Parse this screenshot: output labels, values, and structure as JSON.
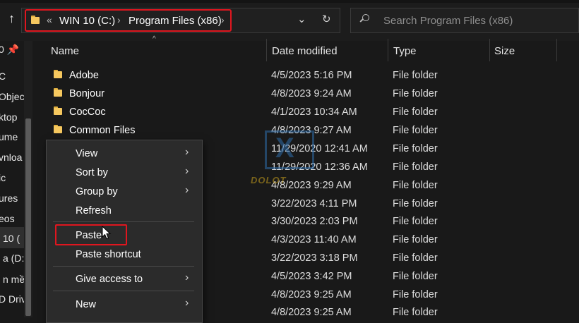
{
  "toolbar": {
    "up_arrow": "↑",
    "breadcrumb_overflow": "«",
    "breadcrumbs": [
      "WIN 10 (C:)",
      "Program Files (x86)"
    ],
    "crumb_separator": "›",
    "dropdown_glyph": "⌄",
    "refresh_glyph": "↻",
    "search_placeholder": "Search Program Files (x86)"
  },
  "navpane": {
    "items": [
      "0 📌",
      "C",
      "Objec",
      "ktop",
      "ume",
      "vnloa",
      "ic",
      "ures",
      "eos",
      "10 (",
      "a (D:",
      "n mề",
      "D Driv"
    ]
  },
  "columns": {
    "name": "Name",
    "date": "Date modified",
    "type": "Type",
    "size": "Size"
  },
  "rows": [
    {
      "name": "Adobe",
      "date": "4/5/2023 5:16 PM",
      "type": "File folder"
    },
    {
      "name": "Bonjour",
      "date": "4/8/2023 9:24 AM",
      "type": "File folder"
    },
    {
      "name": "CocCoc",
      "date": "4/1/2023 10:34 AM",
      "type": "File folder"
    },
    {
      "name": "Common Files",
      "date": "4/8/2023 9:27 AM",
      "type": "File folder"
    },
    {
      "name": "",
      "date": "11/29/2020 12:41 AM",
      "type": "File folder"
    },
    {
      "name": "",
      "date": "11/29/2020 12:36 AM",
      "type": "File folder"
    },
    {
      "name": "",
      "date": "4/8/2023 9:29 AM",
      "type": "File folder"
    },
    {
      "name": "",
      "date": "3/22/2023 4:11 PM",
      "type": "File folder"
    },
    {
      "name": "",
      "date": "3/30/2023 2:03 PM",
      "type": "File folder"
    },
    {
      "name": "",
      "date": "4/3/2023 11:40 AM",
      "type": "File folder"
    },
    {
      "name": "",
      "date": "3/22/2023 3:18 PM",
      "type": "File folder"
    },
    {
      "name": "",
      "date": "4/5/2023 3:42 PM",
      "type": "File folder"
    },
    {
      "name": "",
      "date": "4/8/2023 9:25 AM",
      "type": "File folder"
    },
    {
      "name": "",
      "date": "4/8/2023 9:25 AM",
      "type": "File folder"
    }
  ],
  "context_menu": {
    "view": "View",
    "sort_by": "Sort by",
    "group_by": "Group by",
    "refresh": "Refresh",
    "paste": "Paste",
    "paste_shortcut": "Paste shortcut",
    "give_access_to": "Give access to",
    "new": "New",
    "submenu_glyph": "›"
  },
  "watermark": {
    "text": "DOLOT"
  },
  "colors": {
    "highlight": "#e0161f",
    "folder": "#f6c85f",
    "background": "#191919",
    "menu": "#2b2b2b"
  },
  "icons": [
    "folder-icon",
    "search-icon",
    "up-arrow-icon",
    "refresh-icon",
    "chevron-down-icon",
    "pin-icon",
    "submenu-arrow-icon",
    "cursor-icon"
  ]
}
